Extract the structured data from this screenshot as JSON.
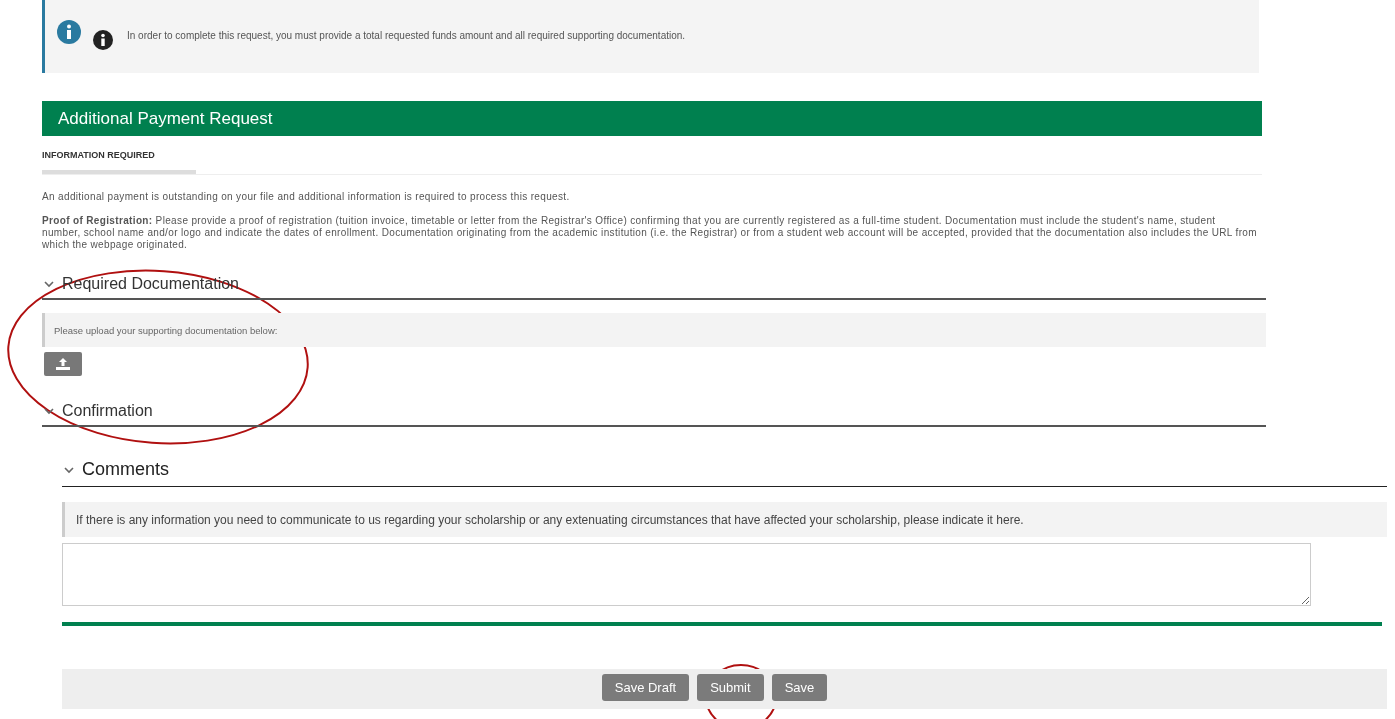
{
  "alert": {
    "text": "In order to complete this request, you must provide a total requested funds amount and all required supporting documentation."
  },
  "header": {
    "title": "Additional Payment Request"
  },
  "tabs": [
    {
      "label": "INFORMATION REQUIRED",
      "selected": true
    }
  ],
  "intro": "An additional payment is outstanding on your file and additional information is required to process this request.",
  "proof": "**Proof of Registration:** Please provide a proof of registration (tuition invoice, timetable or letter from the Registrar's Office) confirming that you are currently registered as a full-time student. Documentation must include the student's name, student number, school name and/or logo and indicate the dates of enrollment. Documentation originating from the academic institution (i.e. the Registrar) or from a student web account will be accepted, provided that the documentation also includes the URL from which the webpage originated.",
  "sections": [
    {
      "title": "Required Documentation",
      "expanded": true,
      "note": "Please upload your supporting documentation below:"
    },
    {
      "title": "Confirmation",
      "expanded": true
    }
  ],
  "comments": {
    "title": "Comments",
    "expanded": true,
    "note": "If there is any information you need to communicate to us regarding your scholarship or any extenuating circumstances that have affected your scholarship, please indicate it here."
  },
  "buttons": [
    "Save Draft",
    "Submit",
    "Save"
  ]
}
